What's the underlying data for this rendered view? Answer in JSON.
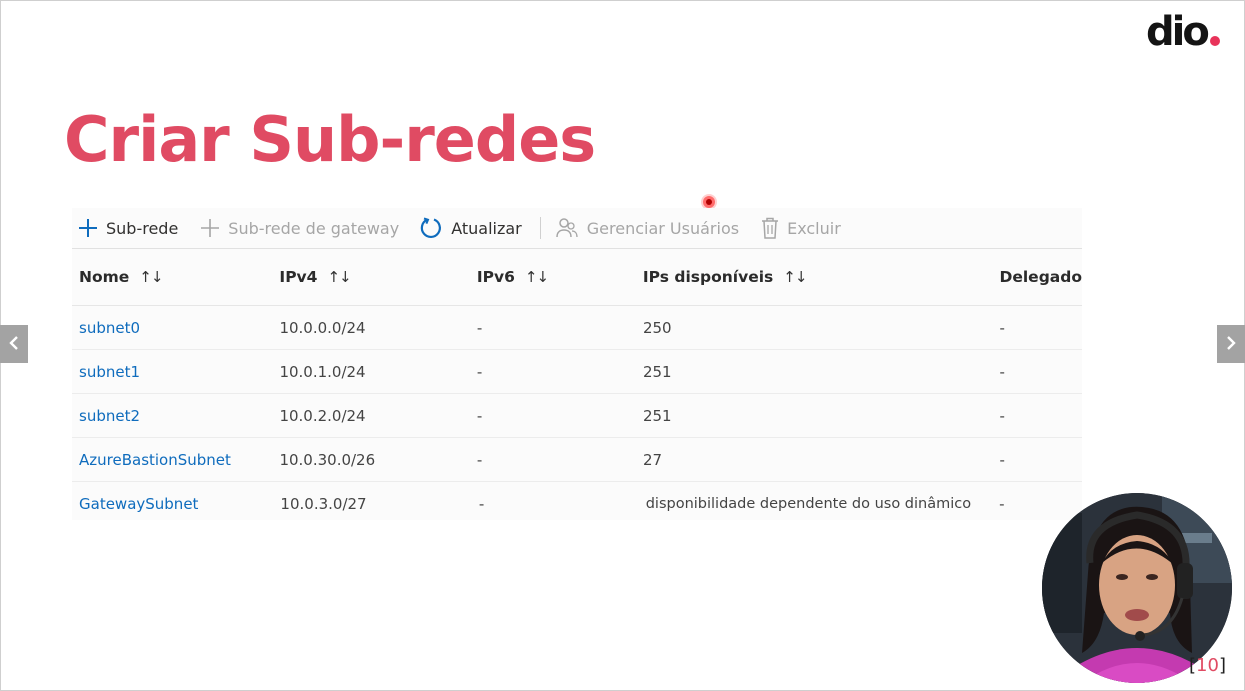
{
  "colors": {
    "title": "#e04b63",
    "logo_dot": "#e8335a",
    "link": "#0f6cbd",
    "accent_blue": "#0f6cbd",
    "pointer": "#ff3b3b"
  },
  "logo": {
    "text": "dio"
  },
  "title": "Criar Sub-redes",
  "toolbar": {
    "items": [
      {
        "icon": "plus-icon",
        "label": "Sub-rede",
        "enabled": true
      },
      {
        "icon": "plus-icon",
        "label": "Sub-rede de gateway",
        "enabled": false
      },
      {
        "icon": "refresh-icon",
        "label": "Atualizar",
        "enabled": true
      },
      {
        "icon": "manage-users-icon",
        "label": "Gerenciar Usuários",
        "enabled": false
      },
      {
        "icon": "trash-icon",
        "label": "Excluir",
        "enabled": false
      }
    ]
  },
  "table": {
    "columns": [
      {
        "label": "Nome",
        "sortable": true
      },
      {
        "label": "IPv4",
        "sortable": true
      },
      {
        "label": "IPv6",
        "sortable": true
      },
      {
        "label": "IPs disponíveis",
        "sortable": true
      },
      {
        "label": "Delegado",
        "sortable": false
      }
    ],
    "sort_glyph": "↑↓",
    "rows": [
      {
        "name": "subnet0",
        "ipv4": "10.0.0.0/24",
        "ipv6": "-",
        "available": "250",
        "delegated": "-"
      },
      {
        "name": "subnet1",
        "ipv4": "10.0.1.0/24",
        "ipv6": "-",
        "available": "251",
        "delegated": "-"
      },
      {
        "name": "subnet2",
        "ipv4": "10.0.2.0/24",
        "ipv6": "-",
        "available": "251",
        "delegated": "-"
      },
      {
        "name": "AzureBastionSubnet",
        "ipv4": "10.0.30.0/26",
        "ipv6": "-",
        "available": "27",
        "delegated": "-"
      },
      {
        "name": "GatewaySubnet",
        "ipv4": "10.0.3.0/27",
        "ipv6": "-",
        "available": "disponibilidade dependente do uso dinâmico",
        "delegated": "-"
      }
    ]
  },
  "navigation": {
    "prev_icon": "chevron-left-icon",
    "next_icon": "chevron-right-icon"
  },
  "page_number": "[10]"
}
